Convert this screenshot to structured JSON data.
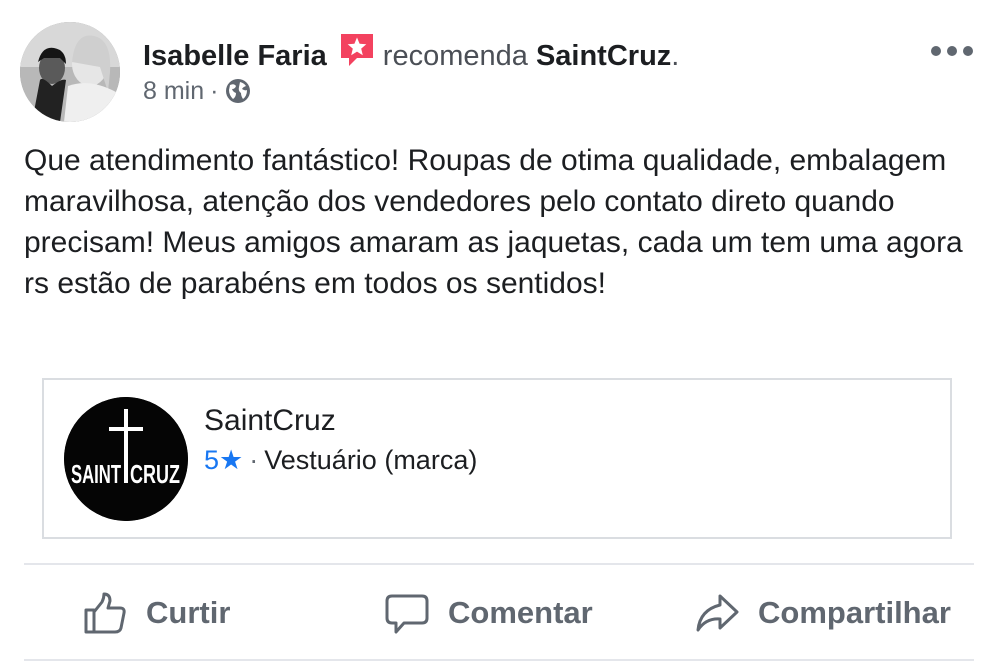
{
  "post": {
    "author": "Isabelle Faria",
    "verb": "recomenda",
    "page_name": "SaintCruz",
    "page_suffix": ".",
    "time": "8 min",
    "meta_separator": "·",
    "text": "Que atendimento fantástico! Roupas de otima qualidade, embalagem maravilhosa, atenção dos vendedores pelo contato direto quando precisam! Meus amigos amaram as jaquetas, cada um tem uma agora rs estão de parabéns em todos os sentidos!"
  },
  "card": {
    "name": "SaintCruz",
    "rating": "5",
    "star": "★",
    "separator": "·",
    "category": "Vestuário (marca)",
    "logo_left": "SAINT",
    "logo_right": "CRUZ"
  },
  "actions": {
    "like": "Curtir",
    "comment": "Comentar",
    "share": "Compartilhar"
  },
  "icons": {
    "recommend": "recommend-star-icon",
    "audience": "globe-icon",
    "more": "more-options-icon",
    "like": "thumbs-up-icon",
    "comment": "comment-bubble-icon",
    "share": "share-arrow-icon"
  },
  "colors": {
    "recommend_badge": "#f3425f",
    "rating_blue": "#1877f2",
    "secondary_text": "#606770",
    "divider": "#e4e6eb"
  }
}
